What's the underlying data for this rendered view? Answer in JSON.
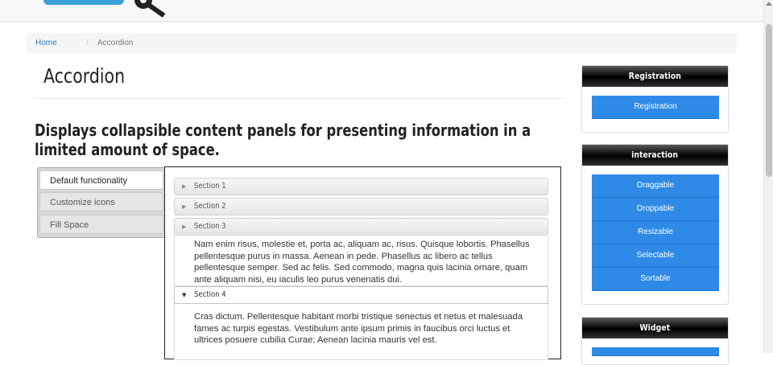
{
  "breadcrumb": {
    "home": "Home",
    "separator": "/",
    "current": "Accordion"
  },
  "page": {
    "title": "Accordion",
    "subtitle": "Displays collapsible content panels for presenting information in a limited amount of space."
  },
  "tabs": [
    {
      "label": "Default functionality",
      "active": true
    },
    {
      "label": "Customize icons",
      "active": false
    },
    {
      "label": "Fill Space",
      "active": false
    }
  ],
  "accordion": {
    "sections": [
      {
        "label": "Section 1",
        "icon": "triangle-right-icon"
      },
      {
        "label": "Section 2",
        "icon": "triangle-right-icon"
      },
      {
        "label": "Section 3",
        "icon": "triangle-right-icon",
        "content": "Nam enim risus, molestie et, porta ac, aliquam ac, risus. Quisque lobortis. Phasellus pellentesque purus in massa. Aenean in pede. Phasellus ac libero ac tellus pellentesque semper. Sed ac felis. Sed commodo, magna quis lacinia ornare, quam ante aliquam nisi, eu iaculis leo purus venenatis dui."
      },
      {
        "label": "Section 4",
        "icon": "triangle-down-icon",
        "content": "Cras dictum. Pellentesque habitant morbi tristique senectus et netus et malesuada fames ac turpis egestas. Vestibulum ante ipsum primis in faucibus orci luctus et ultrices posuere cubilia Curae; Aenean lacinia mauris vel est."
      }
    ]
  },
  "sidebar": {
    "registration": {
      "title": "Registration",
      "buttons": [
        "Registration"
      ]
    },
    "interaction": {
      "title": "interaction",
      "buttons": [
        "Draggable",
        "Droppable",
        "Resizable",
        "Selectable",
        "Sortable"
      ]
    },
    "widget": {
      "title": "Widget"
    }
  },
  "colors": {
    "accent": "#2e8ae6",
    "link": "#337ab7",
    "header_black": "#000000"
  }
}
